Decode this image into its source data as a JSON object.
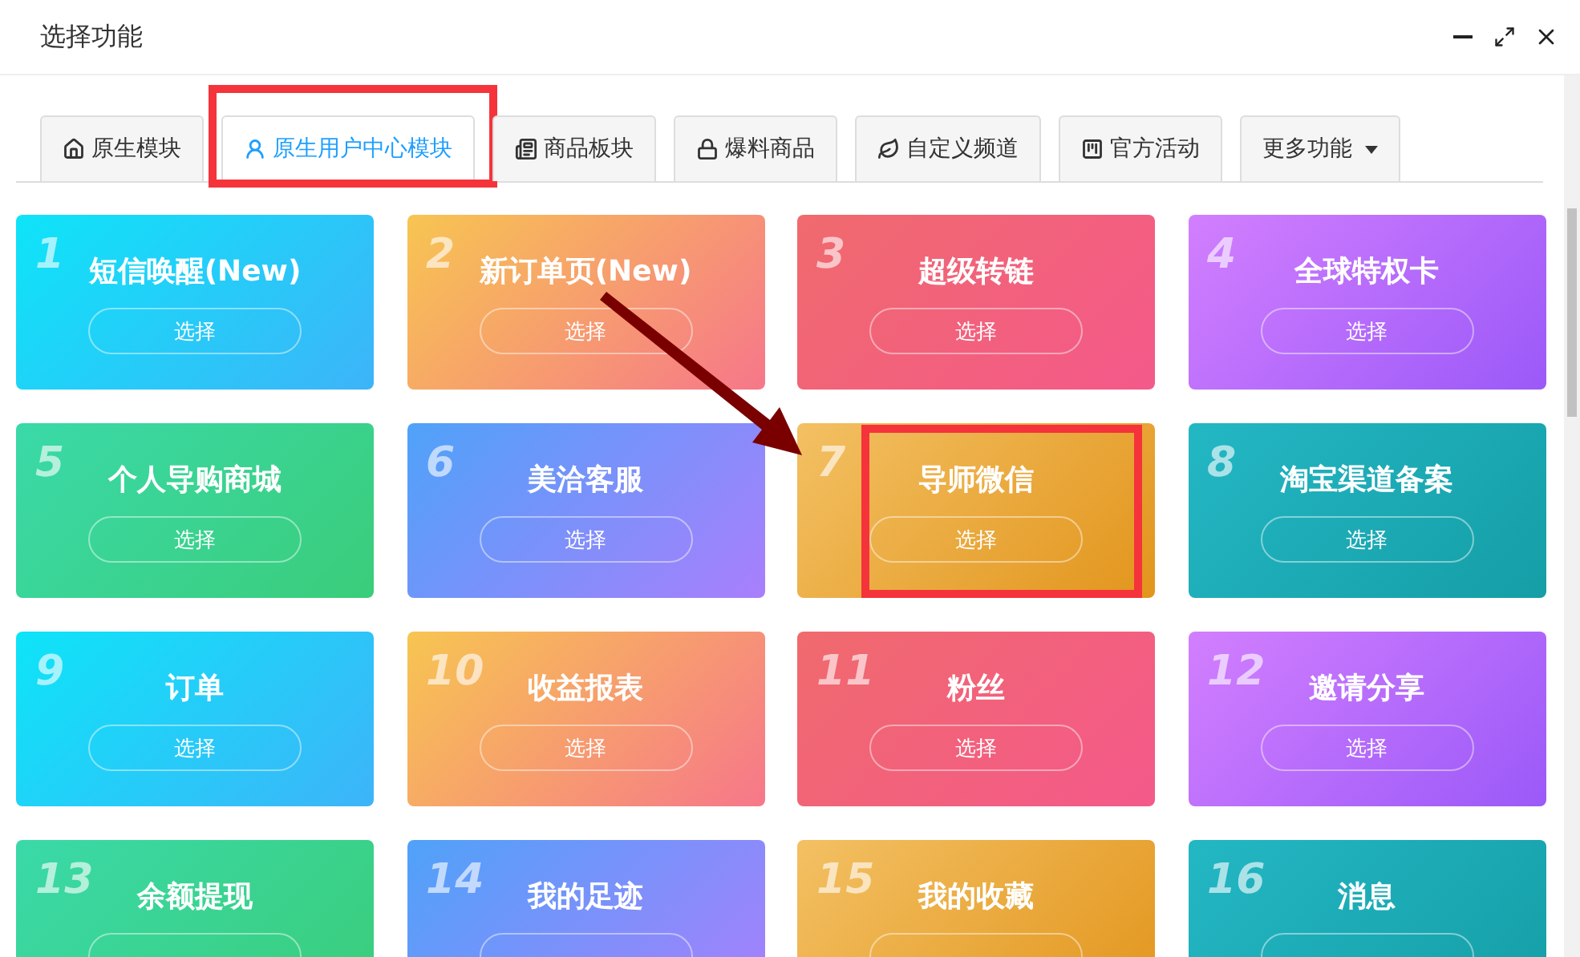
{
  "window": {
    "title": "选择功能"
  },
  "tabs": [
    {
      "label": "原生模块",
      "kind": "home",
      "selected": false,
      "highlighted": false
    },
    {
      "label": "原生用户中心模块",
      "kind": "user",
      "selected": true,
      "highlighted": true
    },
    {
      "label": "商品板块",
      "kind": "list",
      "selected": false,
      "highlighted": false
    },
    {
      "label": "爆料商品",
      "kind": "lock",
      "selected": false,
      "highlighted": false
    },
    {
      "label": "自定义频道",
      "kind": "leaf",
      "selected": false,
      "highlighted": false
    },
    {
      "label": "官方活动",
      "kind": "badge",
      "selected": false,
      "highlighted": false
    },
    {
      "label": "更多功能",
      "kind": "dropdown",
      "selected": false,
      "highlighted": false
    }
  ],
  "cards": [
    {
      "number": "1",
      "title": "短信唤醒(New)",
      "button": "选择",
      "kind": "cyan",
      "highlighted": false
    },
    {
      "number": "2",
      "title": "新订单页(New)",
      "button": "选择",
      "kind": "orange",
      "highlighted": false
    },
    {
      "number": "3",
      "title": "超级转链",
      "button": "选择",
      "kind": "red",
      "highlighted": false
    },
    {
      "number": "4",
      "title": "全球特权卡",
      "button": "选择",
      "kind": "purple",
      "highlighted": false
    },
    {
      "number": "5",
      "title": "个人导购商城",
      "button": "选择",
      "kind": "green",
      "highlighted": false
    },
    {
      "number": "6",
      "title": "美洽客服",
      "button": "选择",
      "kind": "blue",
      "highlighted": false
    },
    {
      "number": "7",
      "title": "导师微信",
      "button": "选择",
      "kind": "gold",
      "highlighted": true
    },
    {
      "number": "8",
      "title": "淘宝渠道备案",
      "button": "选择",
      "kind": "teal",
      "highlighted": false
    },
    {
      "number": "9",
      "title": "订单",
      "button": "选择",
      "kind": "cyan",
      "highlighted": false
    },
    {
      "number": "10",
      "title": "收益报表",
      "button": "选择",
      "kind": "orange",
      "highlighted": false
    },
    {
      "number": "11",
      "title": "粉丝",
      "button": "选择",
      "kind": "red",
      "highlighted": false
    },
    {
      "number": "12",
      "title": "邀请分享",
      "button": "选择",
      "kind": "purple",
      "highlighted": false
    },
    {
      "number": "13",
      "title": "余额提现",
      "kind": "green",
      "highlighted": false
    },
    {
      "number": "14",
      "title": "我的足迹",
      "kind": "blue",
      "highlighted": false
    },
    {
      "number": "15",
      "title": "我的收藏",
      "kind": "gold",
      "highlighted": false
    },
    {
      "number": "16",
      "title": "消息",
      "kind": "teal",
      "highlighted": false
    }
  ]
}
